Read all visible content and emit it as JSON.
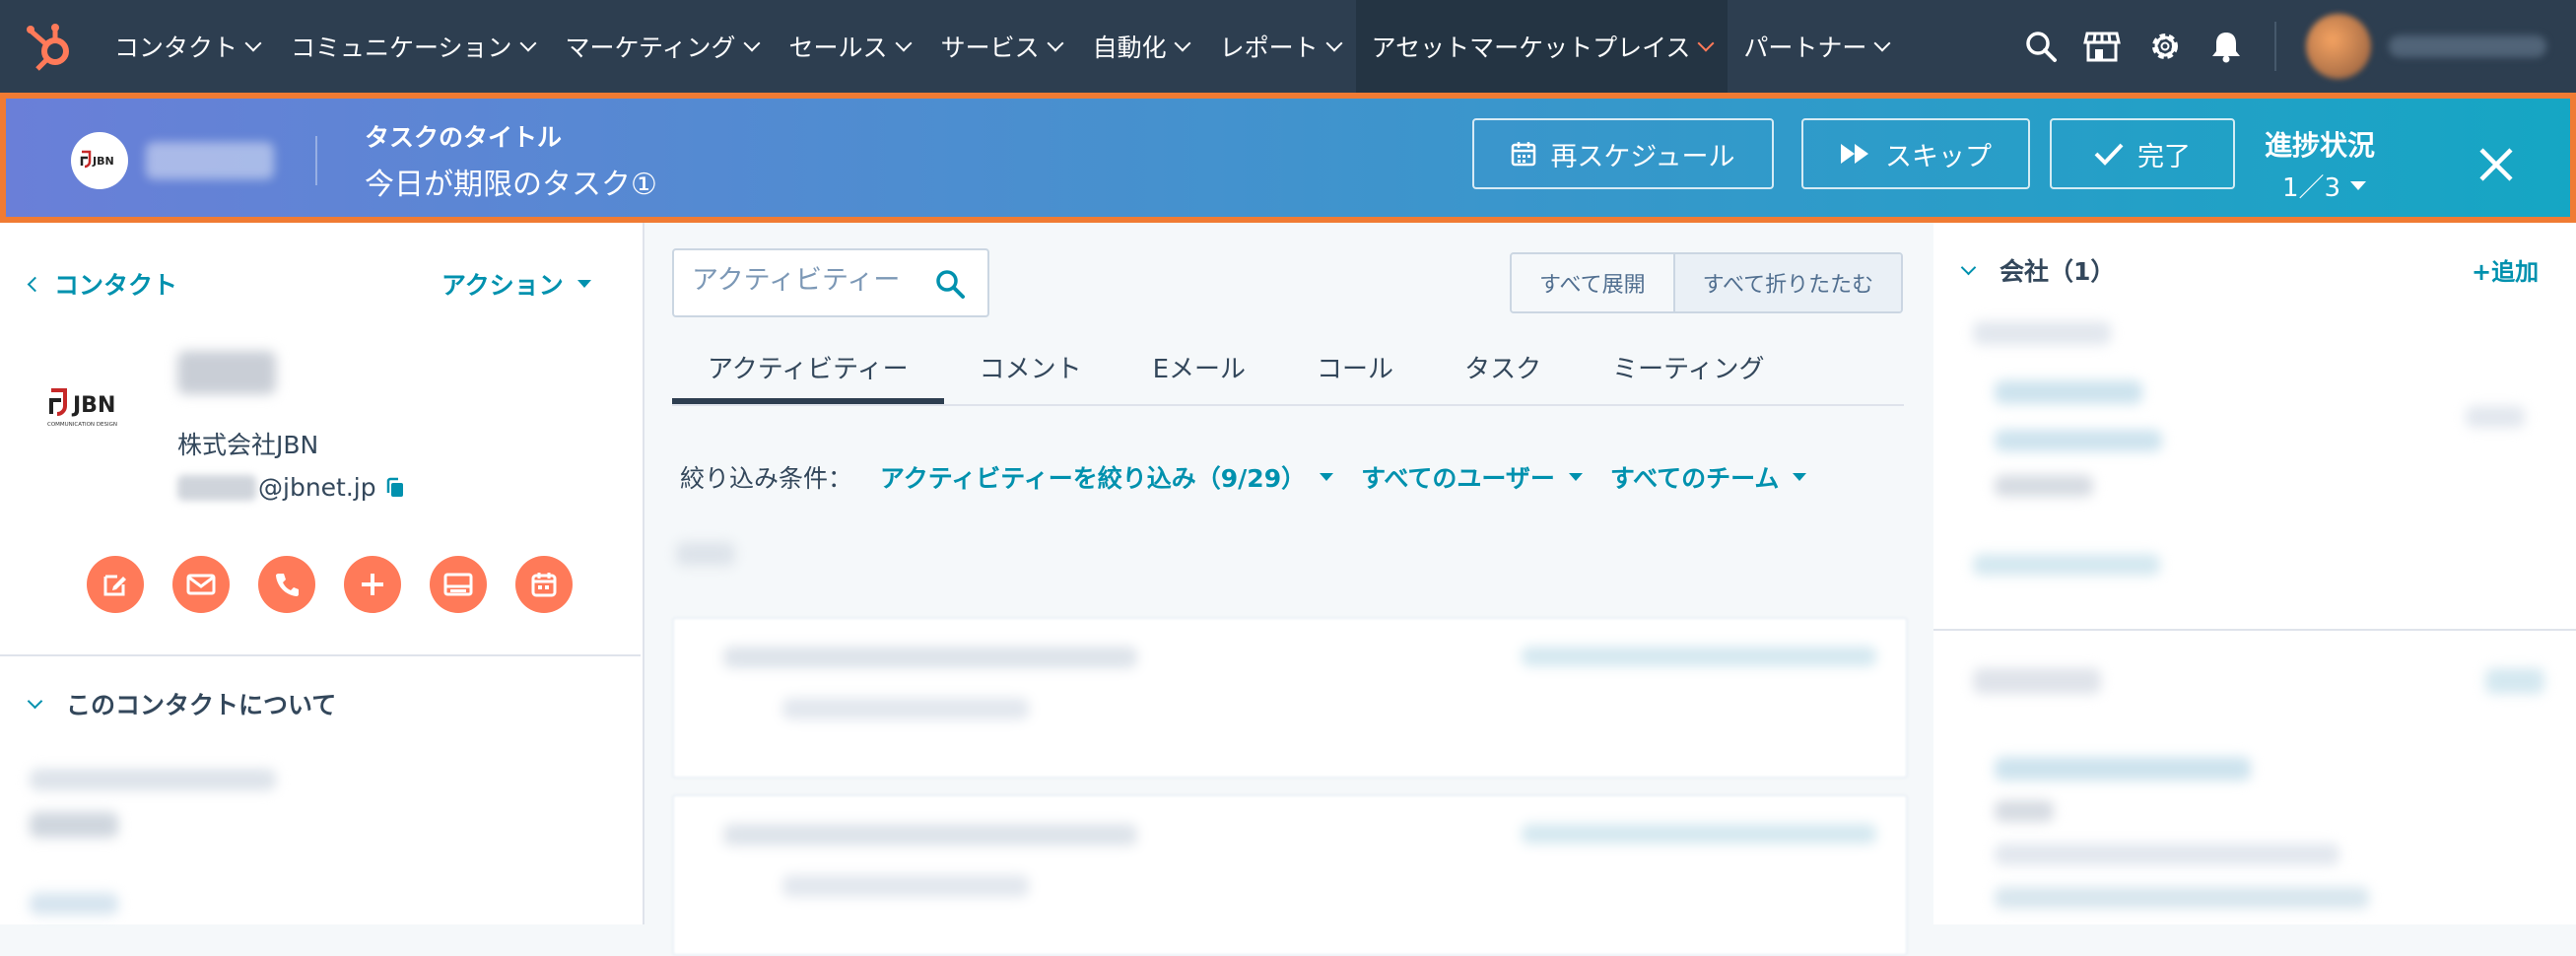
{
  "nav": {
    "items": [
      {
        "label": "コンタクト"
      },
      {
        "label": "コミュニケーション"
      },
      {
        "label": "マーケティング"
      },
      {
        "label": "セールス"
      },
      {
        "label": "サービス"
      },
      {
        "label": "自動化"
      },
      {
        "label": "レポート"
      },
      {
        "label": "アセットマーケットプレイス",
        "active": true
      },
      {
        "label": "パートナー"
      }
    ],
    "icons": [
      "search-icon",
      "marketplace-icon",
      "settings-gear-icon",
      "notifications-bell-icon"
    ],
    "accent_color": "#ff7a59"
  },
  "taskbar": {
    "logo_text": "JBN",
    "title_label": "タスクのタイトル",
    "task_name": "今日が期限のタスク①",
    "reschedule_label": "再スケジュール",
    "skip_label": "スキップ",
    "complete_label": "完了",
    "progress_label": "進捗状況",
    "progress_value": "1／3",
    "border_color": "#f07b33"
  },
  "left": {
    "back_label": "コンタクト",
    "actions_label": "アクション",
    "company": "株式会社JBN",
    "email_domain": "@jbnet.jp",
    "logo_text": "JBN",
    "logo_subtext": "COMMUNICATION DESIGN",
    "action_icons": [
      "note-icon",
      "email-icon",
      "call-icon",
      "add-icon",
      "meeting-icon",
      "calendar-icon"
    ],
    "about_label": "このコンタクトについて"
  },
  "middle": {
    "search_placeholder": "アクティビティー",
    "expand_all": "すべて展開",
    "collapse_all": "すべて折りたたむ",
    "tabs": [
      "アクティビティー",
      "コメント",
      "Eメール",
      "コール",
      "タスク",
      "ミーティング"
    ],
    "filter_label": "絞り込み条件：",
    "filter_activity": "アクティビティーを絞り込み（9/29）",
    "filter_users": "すべてのユーザー",
    "filter_teams": "すべてのチーム"
  },
  "right": {
    "company_label": "会社（1）",
    "add_label": "+追加"
  }
}
